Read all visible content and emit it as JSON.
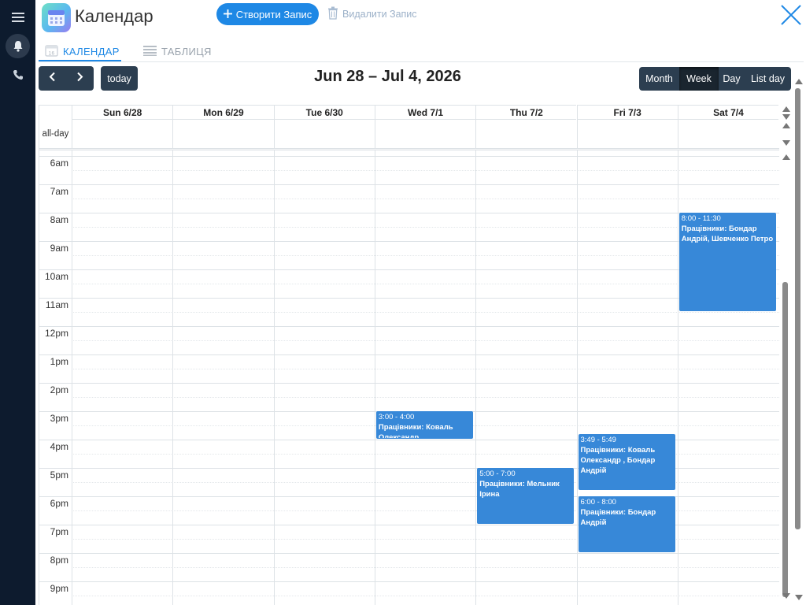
{
  "app": {
    "title": "Календар",
    "create_label": "Створити Запис",
    "delete_label": "Видалити Запис"
  },
  "tabs": [
    {
      "label": "КАЛЕНДАР",
      "active": true
    },
    {
      "label": "ТАБЛИЦЯ",
      "active": false
    }
  ],
  "toolbar": {
    "today_label": "today",
    "title": "Jun 28 – Jul 4, 2026",
    "views": [
      {
        "label": "Month",
        "active": false
      },
      {
        "label": "Week",
        "active": true
      },
      {
        "label": "Day",
        "active": false
      },
      {
        "label": "List day",
        "active": false
      }
    ]
  },
  "grid": {
    "allday_label": "all-day",
    "days": [
      "Sun 6/28",
      "Mon 6/29",
      "Tue 6/30",
      "Wed 7/1",
      "Thu 7/2",
      "Fri 7/3",
      "Sat 7/4"
    ],
    "hours": [
      "6am",
      "7am",
      "8am",
      "9am",
      "10am",
      "11am",
      "12pm",
      "1pm",
      "2pm",
      "3pm",
      "4pm",
      "5pm",
      "6pm",
      "7pm",
      "8pm",
      "9pm"
    ],
    "first_visible_hour": 5.8
  },
  "events": [
    {
      "day": 6,
      "start": 8.0,
      "end": 11.5,
      "time": "8:00 - 11:30",
      "title": "Працівники: Бондар Андрій, Шевченко Петро"
    },
    {
      "day": 3,
      "start": 15.0,
      "end": 16.0,
      "time": "3:00 - 4:00",
      "title": "Працівники: Коваль Олександр"
    },
    {
      "day": 5,
      "start": 15.8,
      "end": 17.8,
      "time": "3:49 - 5:49",
      "title": "Працівники: Коваль Олександр , Бондар Андрій"
    },
    {
      "day": 4,
      "start": 17.0,
      "end": 19.0,
      "time": "5:00 - 7:00",
      "title": "Працівники: Мельник Ірина"
    },
    {
      "day": 5,
      "start": 18.0,
      "end": 20.0,
      "time": "6:00 - 8:00",
      "title": "Працівники: Бондар Андрій"
    }
  ],
  "colors": {
    "accent": "#1e88e5",
    "event": "#3788d8",
    "toolbar": "#2c3e50",
    "rail": "#0d1b2e"
  },
  "icons": [
    "menu-icon",
    "bell-icon",
    "phone-icon",
    "calendar-app-icon",
    "plus-icon",
    "trash-icon",
    "close-icon",
    "calendar-tab-icon",
    "table-tab-icon",
    "chevron-left-icon",
    "chevron-right-icon"
  ]
}
